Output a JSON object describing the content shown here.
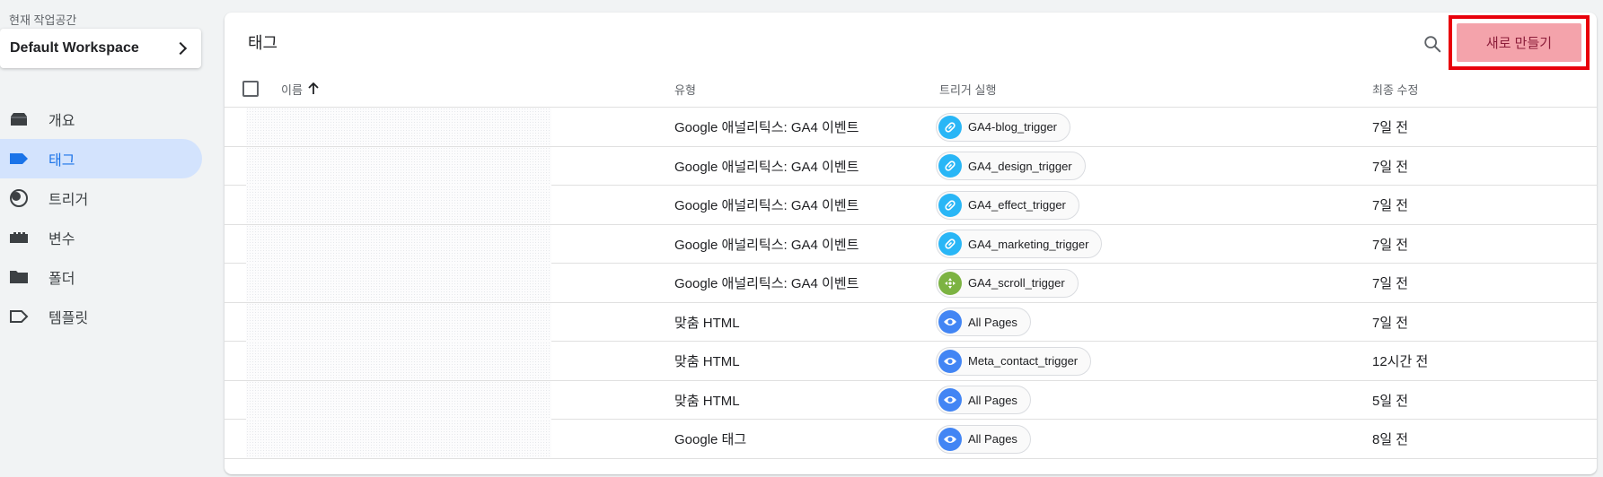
{
  "sidebar": {
    "workspace_label": "현재 작업공간",
    "workspace_name": "Default Workspace",
    "items": [
      {
        "label": "개요",
        "icon": "overview-icon",
        "active": false
      },
      {
        "label": "태그",
        "icon": "tag-icon",
        "active": true
      },
      {
        "label": "트리거",
        "icon": "trigger-icon",
        "active": false
      },
      {
        "label": "변수",
        "icon": "variable-icon",
        "active": false
      },
      {
        "label": "폴더",
        "icon": "folder-icon",
        "active": false
      },
      {
        "label": "템플릿",
        "icon": "template-icon",
        "active": false
      }
    ]
  },
  "main": {
    "title": "태그",
    "new_button": "새로 만들기",
    "columns": {
      "name": "이름",
      "type": "유형",
      "trigger": "트리거 실행",
      "modified": "최종 수정"
    },
    "rows": [
      {
        "type": "Google 애널리틱스: GA4 이벤트",
        "trigger": "GA4-blog_trigger",
        "trigger_icon": "link-icon",
        "modified": "7일 전"
      },
      {
        "type": "Google 애널리틱스: GA4 이벤트",
        "trigger": "GA4_design_trigger",
        "trigger_icon": "link-icon",
        "modified": "7일 전"
      },
      {
        "type": "Google 애널리틱스: GA4 이벤트",
        "trigger": "GA4_effect_trigger",
        "trigger_icon": "link-icon",
        "modified": "7일 전"
      },
      {
        "type": "Google 애널리틱스: GA4 이벤트",
        "trigger": "GA4_marketing_trigger",
        "trigger_icon": "link-icon",
        "modified": "7일 전"
      },
      {
        "type": "Google 애널리틱스: GA4 이벤트",
        "trigger": "GA4_scroll_trigger",
        "trigger_icon": "scroll-icon",
        "modified": "7일 전"
      },
      {
        "type": "맞춤 HTML",
        "trigger": "All Pages",
        "trigger_icon": "eye-icon",
        "modified": "7일 전"
      },
      {
        "type": "맞춤 HTML",
        "trigger": "Meta_contact_trigger",
        "trigger_icon": "eye-icon",
        "modified": "12시간 전"
      },
      {
        "type": "맞춤 HTML",
        "trigger": "All Pages",
        "trigger_icon": "eye-icon",
        "modified": "5일 전"
      },
      {
        "type": "Google 태그",
        "trigger": "All Pages",
        "trigger_icon": "eye-icon",
        "modified": "8일 전"
      }
    ]
  },
  "colors": {
    "accent": "#1a73e8",
    "active_nav_bg": "#d3e3fd",
    "link_chip": "#29b6f6",
    "scroll_chip": "#7cb342",
    "eye_chip": "#4285f4",
    "new_button_bg": "#f4a3ab",
    "highlight_border": "#e8000b"
  }
}
